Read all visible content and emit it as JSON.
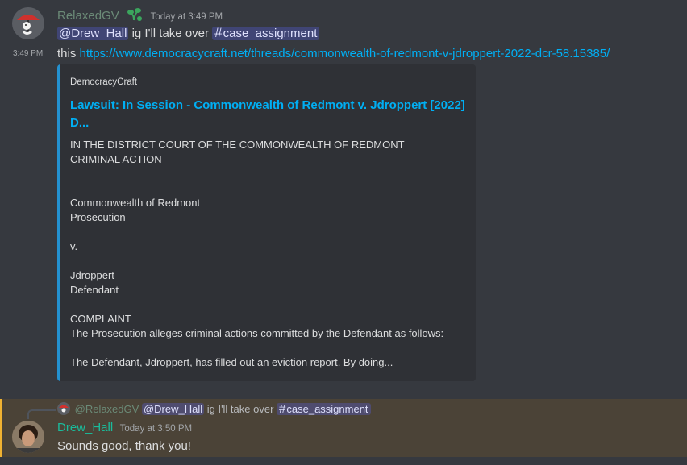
{
  "message1": {
    "author": "RelaxedGV",
    "author_color": "#6b8a77",
    "badge_icon": "sprout-icon",
    "timestamp": "Today at 3:49 PM",
    "mention": "@Drew_Hall",
    "text_mid": " ig I'll take over ",
    "channel": "case_assignment"
  },
  "message2": {
    "side_timestamp": "3:49 PM",
    "text_prefix": "this ",
    "link": "https://www.democracycraft.net/threads/commonwealth-of-redmont-v-jdroppert-2022-dcr-58.15385/"
  },
  "embed": {
    "provider": "DemocracyCraft",
    "title_line1": "Lawsuit: In Session - Commonwealth of Redmont v. Jdroppert [2022]",
    "title_line2": "D...",
    "description": "IN THE DISTRICT COURT OF THE COMMONWEALTH OF REDMONT\nCRIMINAL ACTION\n\n\nCommonwealth of Redmont\nProsecution\n\nv.\n\nJdroppert\nDefendant\n\nCOMPLAINT\nThe Prosecution alleges criminal actions committed by the Defendant as follows:\n\nThe Defendant, Jdroppert, has filled out an eviction report. By doing...",
    "border_color": "#2391d0"
  },
  "reply": {
    "ref_author": "@RelaxedGV",
    "ref_mention": "@Drew_Hall",
    "ref_text": " ig I'll take over ",
    "ref_channel": "case_assignment",
    "author": "Drew_Hall",
    "author_color": "#1abc9c",
    "timestamp": "Today at 3:50 PM",
    "text": "Sounds good, thank you!",
    "highlight_color": "#f0b232"
  }
}
